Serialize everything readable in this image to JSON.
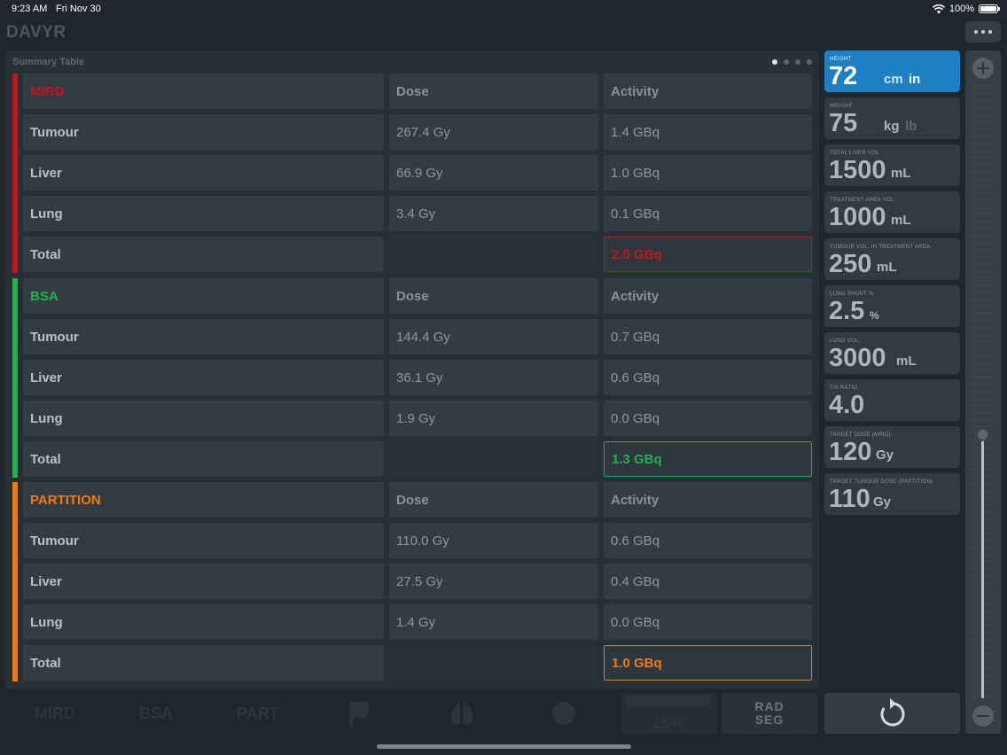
{
  "status": {
    "time": "9:23 AM",
    "date": "Fri Nov 30",
    "battery": "100%"
  },
  "app": {
    "title": "DAVYR"
  },
  "summary": {
    "title": "Summary Table",
    "page_count": 4,
    "active_page": 1,
    "sections": [
      {
        "name": "MIRD",
        "color": "#c0161c",
        "headers": [
          "Dose",
          "Activity"
        ],
        "rows": [
          {
            "label": "Tumour",
            "dose": "267.4 Gy",
            "activity": "1.4 GBq"
          },
          {
            "label": "Liver",
            "dose": "66.9 Gy",
            "activity": "1.0 GBq"
          },
          {
            "label": "Lung",
            "dose": "3.4 Gy",
            "activity": "0.1 GBq"
          }
        ],
        "total_label": "Total",
        "total": "2.5 GBq"
      },
      {
        "name": "BSA",
        "color": "#21b14f",
        "headers": [
          "Dose",
          "Activity"
        ],
        "rows": [
          {
            "label": "Tumour",
            "dose": "144.4 Gy",
            "activity": "0.7 GBq"
          },
          {
            "label": "Liver",
            "dose": "36.1 Gy",
            "activity": "0.6 GBq"
          },
          {
            "label": "Lung",
            "dose": "1.9 Gy",
            "activity": "0.0 GBq"
          }
        ],
        "total_label": "Total",
        "total": "1.3 GBq"
      },
      {
        "name": "PARTITION",
        "color": "#ee7a16",
        "headers": [
          "Dose",
          "Activity"
        ],
        "rows": [
          {
            "label": "Tumour",
            "dose": "110.0 Gy",
            "activity": "0.6 GBq"
          },
          {
            "label": "Liver",
            "dose": "27.5 Gy",
            "activity": "0.4 GBq"
          },
          {
            "label": "Lung",
            "dose": "1.4 Gy",
            "activity": "0.0 GBq"
          }
        ],
        "total_label": "Total",
        "total": "1.0 GBq"
      }
    ]
  },
  "toolbar": {
    "mird": "MIRD",
    "bsa": "BSA",
    "part": "PART",
    "shunt_value": "25%",
    "radseg_line1": "RAD",
    "radseg_line2": "SEG"
  },
  "params": [
    {
      "label": "HEIGHT",
      "value": "72",
      "unit": "cm",
      "unit_alt": "in",
      "active": true
    },
    {
      "label": "WEIGHT",
      "value": "75",
      "unit": "kg",
      "unit_alt": "lb",
      "active": false
    },
    {
      "label": "TOTAL LIVER VOL.",
      "value": "1500",
      "unit": "mL"
    },
    {
      "label": "TREATMENT AREA VOL.",
      "value": "1000",
      "unit": "mL"
    },
    {
      "label": "TUMOUR VOL. IN TREATMENT AREA",
      "value": "250",
      "unit": "mL"
    },
    {
      "label": "LUNG SHUNT %",
      "value": "2.5",
      "unit": "%"
    },
    {
      "label": "LUNG VOL.",
      "value": "3000",
      "unit": "mL"
    },
    {
      "label": "T:N RATIO",
      "value": "4.0",
      "unit": ""
    },
    {
      "label": "TARGET DOSE (MIRD)",
      "value": "120",
      "unit": "Gy"
    },
    {
      "label": "TARGET TUMOUR DOSE (PARTITION)",
      "value": "110",
      "unit": "Gy"
    }
  ],
  "slider": {
    "level_fraction": 0.39
  },
  "colors": {
    "accent": "#1e7fc4",
    "mird": "#c0161c",
    "bsa": "#21b14f",
    "partition": "#ee7a16"
  }
}
